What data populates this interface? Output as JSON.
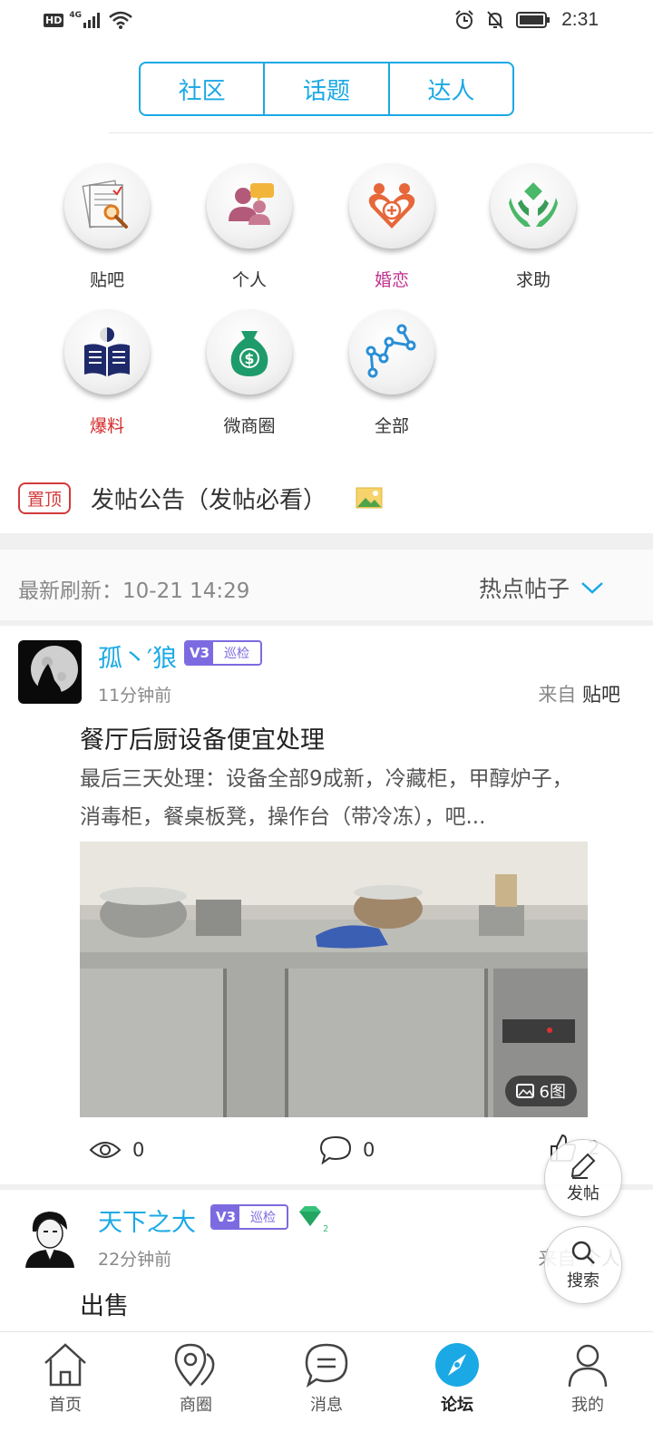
{
  "status_bar": {
    "hd": "HD",
    "network": "4G",
    "time": "2:31"
  },
  "tabs": [
    {
      "label": "社区",
      "active": true
    },
    {
      "label": "话题",
      "active": false
    },
    {
      "label": "达人",
      "active": false
    }
  ],
  "categories": [
    {
      "label": "贴吧",
      "color": "#333333",
      "icon": "document-search-icon"
    },
    {
      "label": "个人",
      "color": "#333333",
      "icon": "people-chat-icon"
    },
    {
      "label": "婚恋",
      "color": "#c2338f",
      "icon": "heart-couple-icon"
    },
    {
      "label": "求助",
      "color": "#333333",
      "icon": "helping-hands-icon"
    },
    {
      "label": "爆料",
      "color": "#d42a2a",
      "icon": "reader-book-icon"
    },
    {
      "label": "微商圈",
      "color": "#333333",
      "icon": "money-bag-icon"
    },
    {
      "label": "全部",
      "color": "#333333",
      "icon": "nodes-graph-icon"
    }
  ],
  "pinned": {
    "badge": "置顶",
    "title": "发帖公告（发帖必看）",
    "icon": "image-icon"
  },
  "refresh": {
    "text": "最新刷新：10-21 14:29",
    "sort_label": "热点帖子"
  },
  "posts": [
    {
      "user": "孤丶′狼",
      "level": "V3",
      "role": "巡检",
      "time": "11分钟前",
      "source_prefix": "来自",
      "source": "贴吧",
      "title": "餐厅后厨设备便宜处理",
      "body": "最后三天处理：设备全部9成新，冷藏柜，甲醇炉子，消毒柜，餐桌板凳，操作台（带冷冻），吧...",
      "image_count": "6图",
      "views": "0",
      "comments": "0",
      "likes": "2"
    },
    {
      "user": "天下之大",
      "level": "V3",
      "role": "巡检",
      "gem_level": "2",
      "time": "22分钟前",
      "source_prefix": "来自",
      "source": "个人",
      "title": "出售"
    }
  ],
  "fab": {
    "post": "发帖",
    "search": "搜索"
  },
  "nav": [
    {
      "label": "首页",
      "icon": "home-icon",
      "active": false
    },
    {
      "label": "商圈",
      "icon": "location-icon",
      "active": false
    },
    {
      "label": "消息",
      "icon": "message-icon",
      "active": false
    },
    {
      "label": "论坛",
      "icon": "compass-icon",
      "active": true
    },
    {
      "label": "我的",
      "icon": "person-icon",
      "active": false
    }
  ],
  "colors": {
    "accent": "#1aa9e5",
    "badge": "#7c6be0",
    "pin": "#d23a3a"
  }
}
